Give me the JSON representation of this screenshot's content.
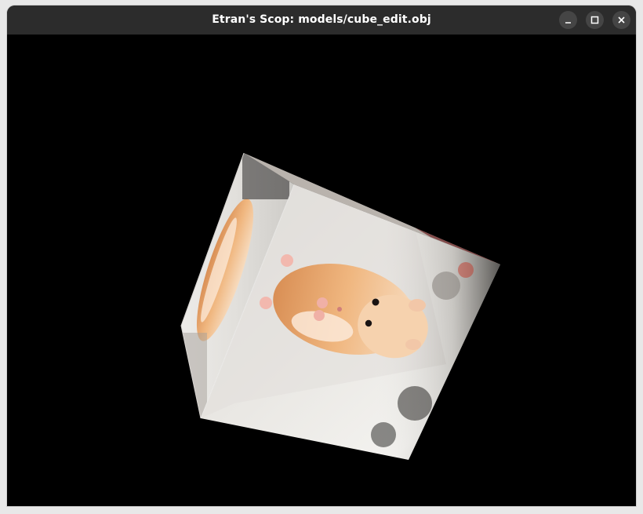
{
  "window": {
    "title": "Etran's Scop: models/cube_edit.obj",
    "controls": {
      "minimize_icon": "minimize-icon",
      "maximize_icon": "maximize-icon",
      "close_icon": "close-icon"
    }
  },
  "viewport": {
    "background": "#000000",
    "model": "textured-cube",
    "texture": "hamster-photo"
  }
}
